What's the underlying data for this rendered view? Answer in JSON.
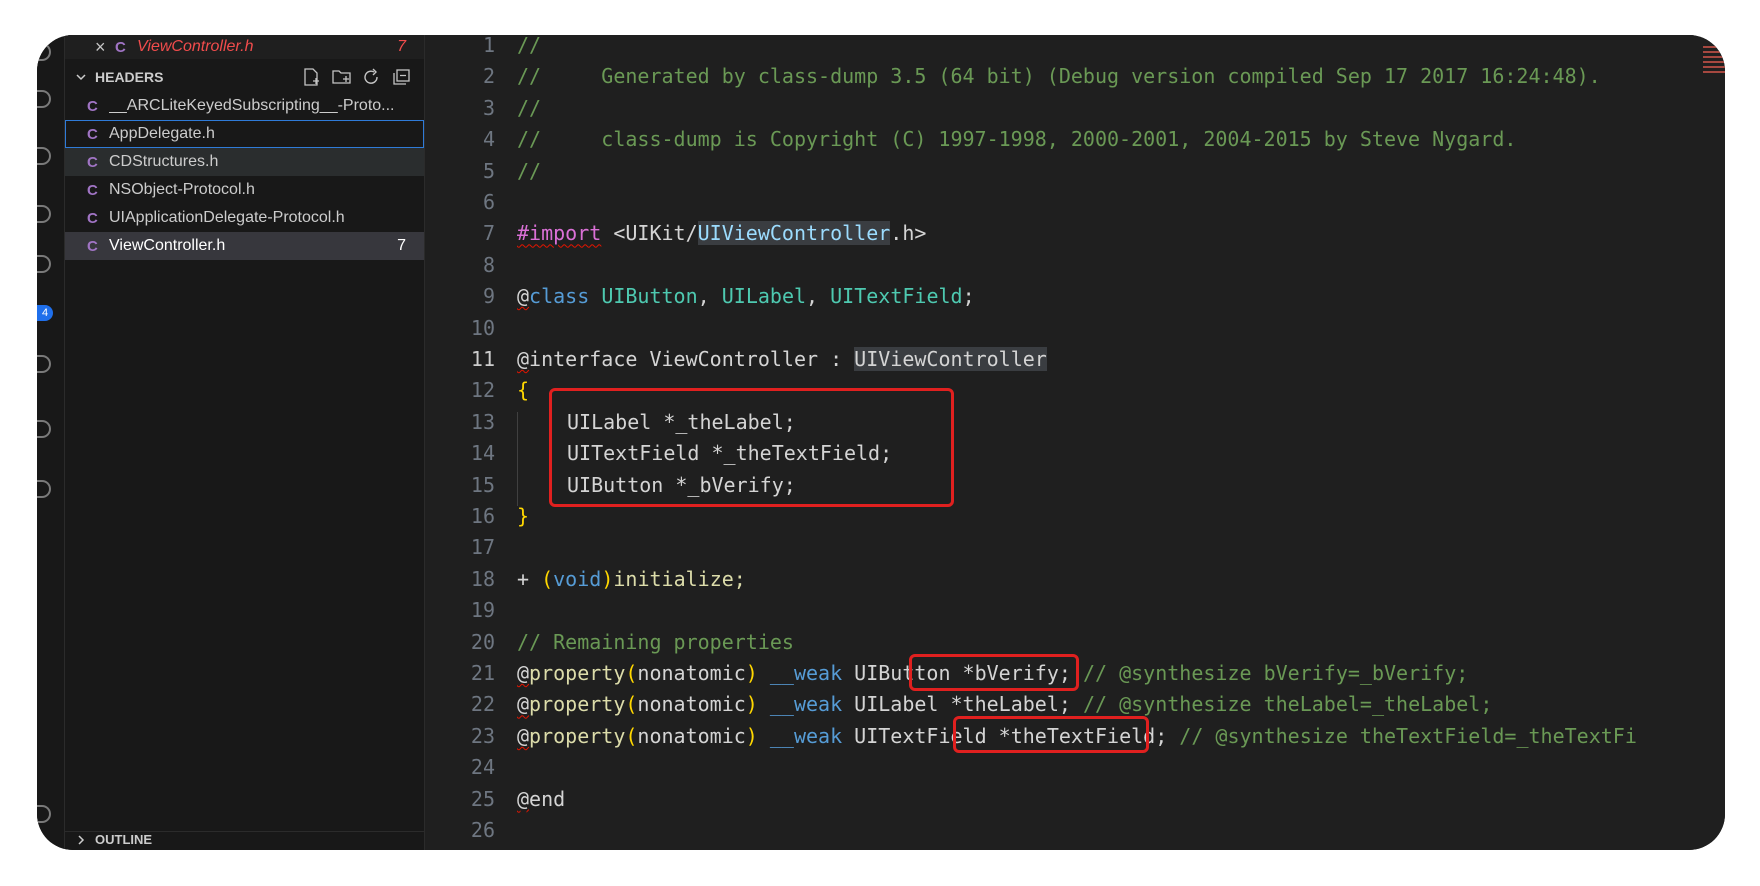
{
  "colors": {
    "error": "#f14c4c",
    "annotation_box": "#e0201f",
    "c_file_icon": "#a074c4"
  },
  "open_editor": {
    "icon": "C",
    "name": "ViewController.h",
    "count": "7"
  },
  "explorer": {
    "section_title": "HEADERS",
    "actions": [
      "new-file-icon",
      "new-folder-icon",
      "refresh-icon",
      "collapse-all-icon"
    ],
    "files": [
      {
        "icon": "C",
        "name": "__ARCLiteKeyedSubscripting__-Proto...",
        "count": ""
      },
      {
        "icon": "C",
        "name": "AppDelegate.h",
        "count": ""
      },
      {
        "icon": "C",
        "name": "CDStructures.h",
        "count": ""
      },
      {
        "icon": "C",
        "name": "NSObject-Protocol.h",
        "count": ""
      },
      {
        "icon": "C",
        "name": "UIApplicationDelegate-Protocol.h",
        "count": ""
      },
      {
        "icon": "C",
        "name": "ViewController.h",
        "count": "7"
      }
    ],
    "outline_title": "OUTLINE"
  },
  "activity_bar": {
    "badge": "4"
  },
  "editor": {
    "current_line": "11",
    "lines": [
      {
        "n": "1"
      },
      {
        "n": "2"
      },
      {
        "n": "3"
      },
      {
        "n": "4"
      },
      {
        "n": "5"
      },
      {
        "n": "6"
      },
      {
        "n": "7"
      },
      {
        "n": "8"
      },
      {
        "n": "9"
      },
      {
        "n": "10"
      },
      {
        "n": "11"
      },
      {
        "n": "12"
      },
      {
        "n": "13"
      },
      {
        "n": "14"
      },
      {
        "n": "15"
      },
      {
        "n": "16"
      },
      {
        "n": "17"
      },
      {
        "n": "18"
      },
      {
        "n": "19"
      },
      {
        "n": "20"
      },
      {
        "n": "21"
      },
      {
        "n": "22"
      },
      {
        "n": "23"
      },
      {
        "n": "24"
      },
      {
        "n": "25"
      },
      {
        "n": "26"
      }
    ],
    "code": {
      "l1": "//",
      "l2": "//     Generated by class-dump 3.5 (64 bit) (Debug version compiled Sep 17 2017 16:24:48).",
      "l3": "//",
      "l4": "//     class-dump is Copyright (C) 1997-1998, 2000-2001, 2004-2015 by Steve Nygard.",
      "l5": "//",
      "l7_import": "#import",
      "l7_lt": " <UIKit/",
      "l7_header": "UIViewController",
      "l7_rest": ".h>",
      "l9_at": "@",
      "l9_class": "class",
      "l9_t1": "UIButton",
      "l9_t2": "UILabel",
      "l9_t3": "UITextField",
      "l11_at": "@",
      "l11_rest": "interface ViewController : ",
      "l11_super": "UIViewController",
      "l12": "{",
      "l13": "UILabel *_theLabel;",
      "l14": "UITextField *_theTextField;",
      "l15": "UIButton *_bVerify;",
      "l16": "}",
      "l18_plus": "+ ",
      "l18_open": "(",
      "l18_void": "void",
      "l18_close": ")",
      "l18_name": "initialize;",
      "l20": "// Remaining properties",
      "prop_at": "@",
      "prop_kw": "property",
      "prop_open": "(",
      "prop_attr": "nonatomic",
      "prop_close": ")",
      "prop_weak": "__weak",
      "l21_decl": " UIButton *bVerify; ",
      "l21_comment": "// @synthesize bVerify=_bVerify;",
      "l22_decl": " UILabel *theLabel; ",
      "l22_comment": "// @synthesize theLabel=_theLabel;",
      "l23_decl": " UITextField *theTextField; ",
      "l23_comment": "// @synthesize theTextField=_theTextFi",
      "l25_at": "@",
      "l25_end": "end"
    }
  }
}
